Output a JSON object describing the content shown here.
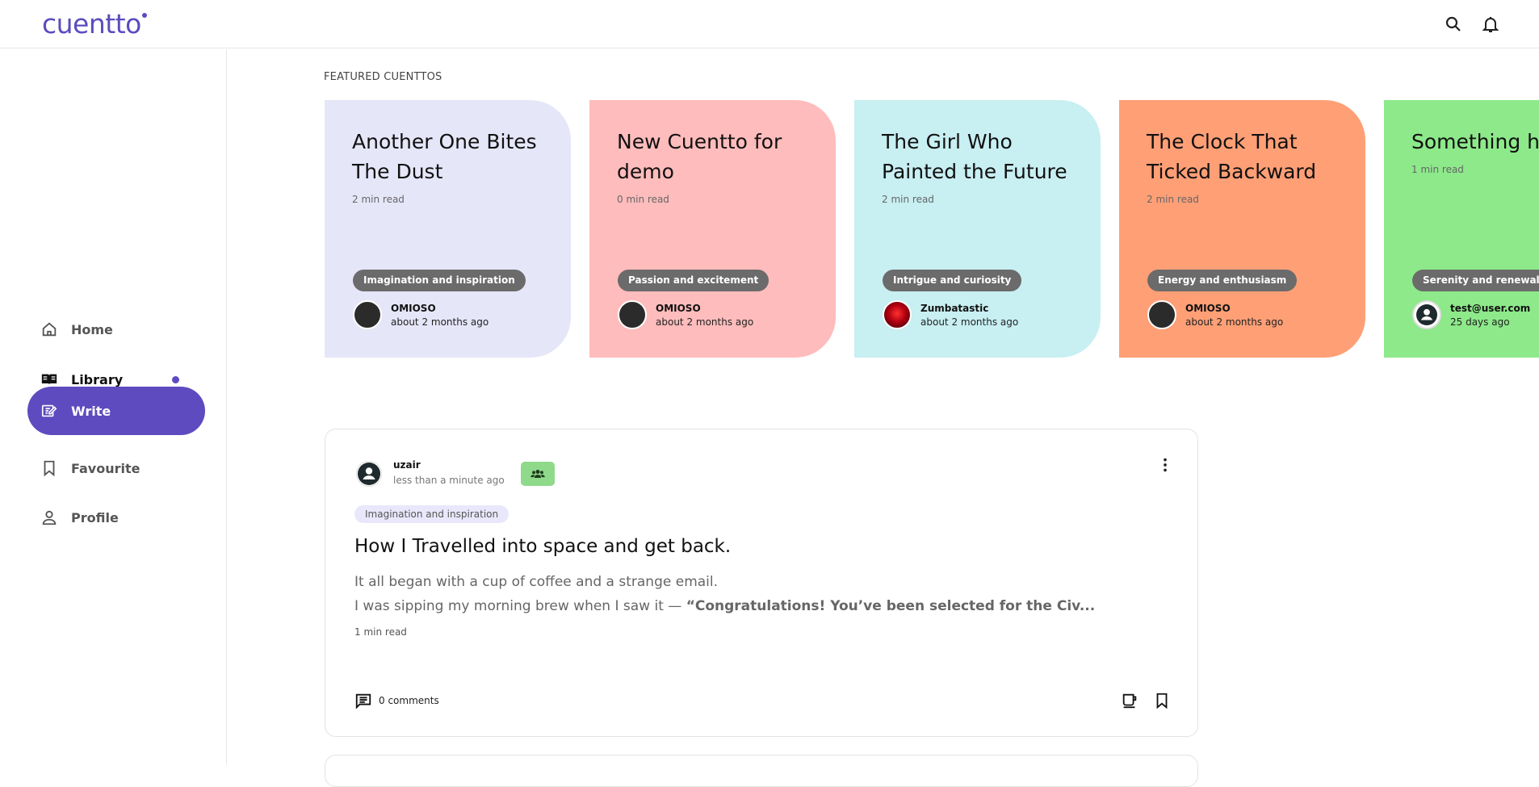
{
  "app": {
    "logo_text": "cuentto",
    "brand_color": "#5b4cbf"
  },
  "topbar": {
    "icons": [
      "search-icon",
      "bell-icon"
    ]
  },
  "sidebar": {
    "items": [
      {
        "label": "Home",
        "icon": "home-icon"
      },
      {
        "label": "Library",
        "icon": "book-open-icon",
        "has_dot": true
      },
      {
        "label": "Write",
        "icon": "write-icon"
      },
      {
        "label": "Favourite",
        "icon": "bookmark-icon"
      },
      {
        "label": "Profile",
        "icon": "person-icon"
      }
    ]
  },
  "featured": {
    "section_title": "FEATURED CUENTTOS",
    "cards": [
      {
        "title": "Another One Bites The Dust",
        "read_time": "2 min read",
        "tag": "Imagination and inspiration",
        "author": "OMIOSO",
        "date": "about 2 months ago",
        "color": "#e6e6f9"
      },
      {
        "title": "New Cuentto for demo",
        "read_time": "0 min read",
        "tag": "Passion and excitement",
        "author": "OMIOSO",
        "date": "about 2 months ago",
        "color": "#ffbcbc"
      },
      {
        "title": "The Girl Who Painted the Future",
        "read_time": "2 min read",
        "tag": "Intrigue and curiosity",
        "author": "Zumbatastic",
        "date": "about 2 months ago",
        "color": "#c8eff2"
      },
      {
        "title": "The Clock That Ticked Backward",
        "read_time": "2 min read",
        "tag": "Energy and enthusiasm",
        "author": "OMIOSO",
        "date": "about 2 months ago",
        "color": "#ff9f76"
      },
      {
        "title": "Something he must be read",
        "read_time": "1 min read",
        "tag": "Serenity and renewal",
        "author": "test@user.com",
        "date": "25 days ago",
        "color": "#8de98a"
      }
    ]
  },
  "post": {
    "author": "uzair",
    "time": "less than a minute ago",
    "tag": "Imagination and inspiration",
    "title": "How I Travelled into space and get back.",
    "body_line1": "It all began with a cup of coffee and a strange email.",
    "body_line2_prefix": "I was sipping my morning brew when I saw it — ",
    "body_line2_bold": "“Congratulations! You’ve been selected for the Civ...",
    "read_time": "1 min read",
    "comments_label": "0 comments",
    "badge_color": "#8fd98b"
  }
}
